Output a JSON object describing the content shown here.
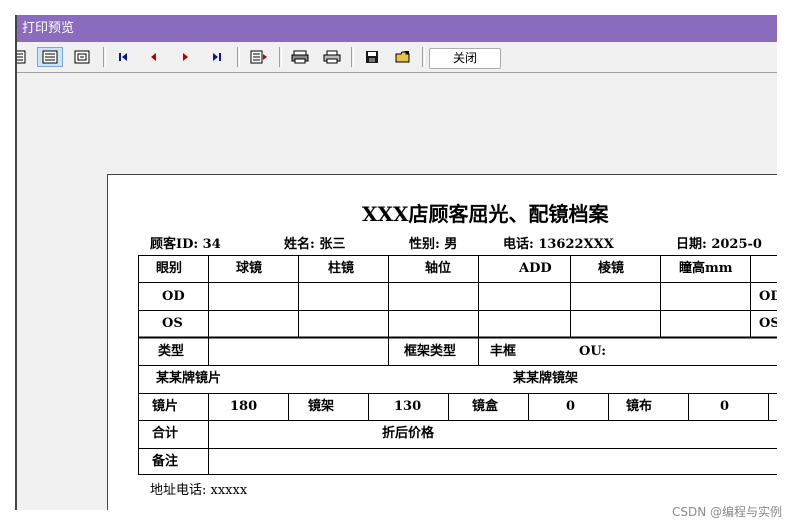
{
  "window": {
    "title": "打印预览"
  },
  "toolbar": {
    "close_label": "关闭",
    "icons": [
      "one-page-icon",
      "whole-page-icon",
      "zoom-page-icon",
      "first-page-icon",
      "prev-page-icon",
      "next-page-icon",
      "last-page-icon",
      "goto-page-icon",
      "print-setup-icon",
      "print-icon",
      "save-icon",
      "open-icon"
    ]
  },
  "doc": {
    "title": "XXX店顾客屈光、配镜档案",
    "info": {
      "customer_id": "顾客ID: 34",
      "name": "姓名: 张三",
      "gender": "性别: 男",
      "phone": "电话: 13622XXX",
      "date": "日期: 2025-0"
    },
    "header": {
      "eye": "眼别",
      "sphere": "球镜",
      "cylinder": "柱镜",
      "axis": "轴位",
      "add": "ADD",
      "prism": "棱镜",
      "pupil_height": "瞳高mm"
    },
    "rows": {
      "od": "OD",
      "os": "OS",
      "od_right": "OD",
      "os_right": "OS"
    },
    "type_row": {
      "type": "类型",
      "frame_type": "框架类型",
      "frame_value": "丰框",
      "ou": "OU:"
    },
    "brands": {
      "lens_brand": "某某牌镜片",
      "frame_brand": "某某牌镜架"
    },
    "prices": {
      "lens": "镜片",
      "lens_value": "180",
      "frame": "镜架",
      "frame_value": "130",
      "box": "镜盒",
      "box_value": "0",
      "cloth": "镜布",
      "cloth_value": "0"
    },
    "total": {
      "label": "合计",
      "discount": "折后价格"
    },
    "remark": {
      "label": "备注"
    },
    "address": "地址电话: xxxxx"
  },
  "watermark": "CSDN @编程与实例"
}
